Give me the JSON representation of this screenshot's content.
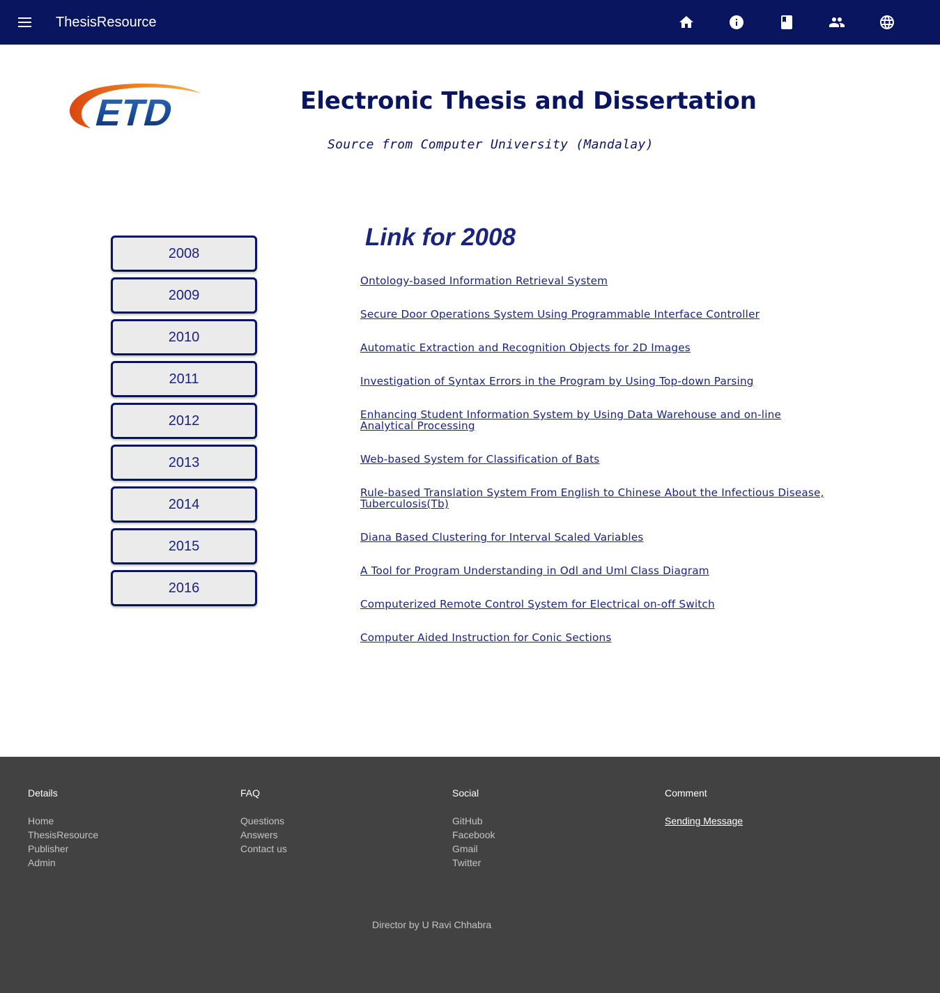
{
  "appbar": {
    "title": "ThesisResource",
    "icons": [
      "menu-icon",
      "home-icon",
      "info-icon",
      "book-icon",
      "people-icon",
      "globe-icon"
    ],
    "colors": {
      "background": "#0a1560",
      "icon": "#ffffff"
    }
  },
  "hero": {
    "logo_text": "ETD",
    "title": "Electronic Thesis and Dissertation",
    "subtitle": "Source from Computer University (Mandalay)"
  },
  "years": [
    "2008",
    "2009",
    "2010",
    "2011",
    "2012",
    "2013",
    "2014",
    "2015",
    "2016"
  ],
  "links_panel": {
    "heading": "Link for 2008",
    "links": [
      "Ontology-based Information Retrieval System",
      "Secure Door Operations System Using Programmable Interface Controller",
      "Automatic Extraction and Recognition Objects for 2D Images",
      "Investigation of Syntax Errors in the Program by Using Top-down Parsing",
      "Enhancing Student Information System by Using Data Warehouse and on-line Analytical Processing",
      "Web-based System for Classification of Bats",
      "Rule-based Translation System From English to Chinese About the Infectious Disease, Tuberculosis(Tb)",
      "Diana Based Clustering for Interval Scaled Variables",
      "A Tool for Program Understanding in Odl and Uml Class Diagram",
      "Computerized Remote Control System for Electrical on-off Switch",
      "Computer Aided Instruction for Conic Sections"
    ]
  },
  "footer": {
    "columns": [
      {
        "heading": "Details",
        "links": [
          "Home",
          "ThesisResource",
          "Publisher",
          "Admin"
        ]
      },
      {
        "heading": "FAQ",
        "links": [
          "Questions",
          "Answers",
          "Contact us"
        ]
      },
      {
        "heading": "Social",
        "links": [
          "GitHub",
          "Facebook",
          "Gmail",
          "Twitter"
        ]
      },
      {
        "heading": "Comment",
        "links": [
          "Sending Message"
        ]
      }
    ],
    "credit": "Director by U Ravi Chhabra",
    "colors": {
      "background": "#424242"
    }
  }
}
